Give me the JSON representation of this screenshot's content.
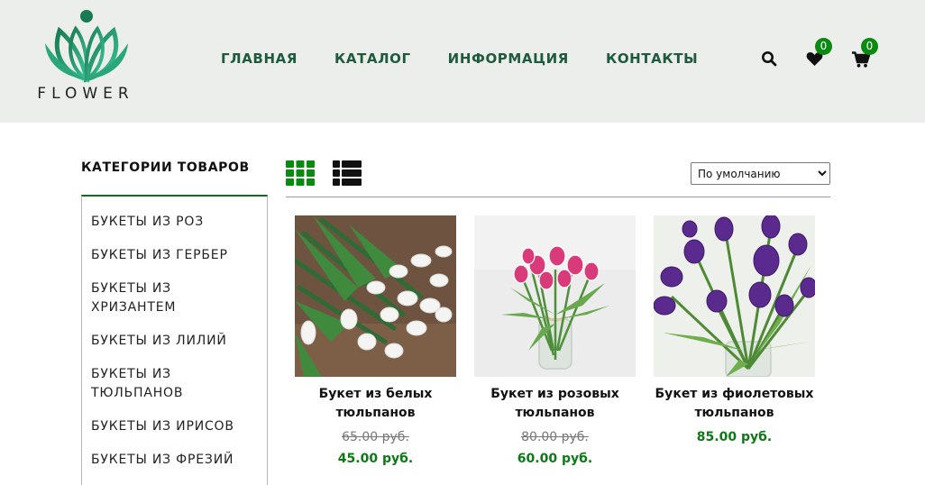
{
  "logo": {
    "text": "FLOWER"
  },
  "nav": [
    "ГЛАВНАЯ",
    "КАТАЛОГ",
    "ИНФОРМАЦИЯ",
    "КОНТАКТЫ"
  ],
  "header_icons": {
    "search": "search-icon",
    "wishlist": {
      "icon": "heart-icon",
      "count": "0"
    },
    "cart": {
      "icon": "cart-icon",
      "count": "0"
    }
  },
  "sidebar": {
    "title": "КАТЕГОРИИ ТОВАРОВ",
    "items": [
      "БУКЕТЫ ИЗ РОЗ",
      "БУКЕТЫ ИЗ ГЕРБЕР",
      "БУКЕТЫ ИЗ ХРИЗАНТЕМ",
      "БУКЕТЫ ИЗ ЛИЛИЙ",
      "БУКЕТЫ ИЗ ТЮЛЬПАНОВ",
      "БУКЕТЫ ИЗ ИРИСОВ",
      "БУКЕТЫ ИЗ ФРЕЗИЙ"
    ]
  },
  "toolbar": {
    "grid_view": "grid-icon",
    "list_view": "list-icon",
    "sort_selected": "По умолчанию"
  },
  "products": [
    {
      "name": "Букет из белых тюльпанов",
      "old_price": "65.00 руб.",
      "price": "45.00 руб."
    },
    {
      "name": "Букет из розовых тюльпанов",
      "old_price": "80.00 руб.",
      "price": "60.00 руб."
    },
    {
      "name": "Букет из фиолетовых тюльпанов",
      "price": "85.00 руб."
    }
  ],
  "colors": {
    "accent": "#0b7a15",
    "nav": "#1f5a3c",
    "header_bg": "#ebeeeb"
  }
}
